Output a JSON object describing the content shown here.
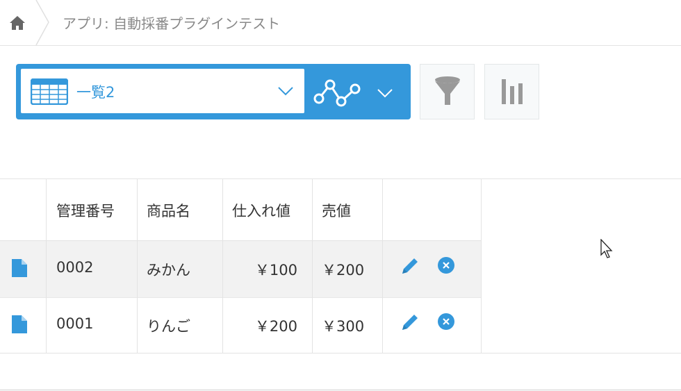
{
  "breadcrumb": {
    "text": "アプリ: 自動採番プラグインテスト"
  },
  "view": {
    "name": "一覧2"
  },
  "table": {
    "headers": [
      "管理番号",
      "商品名",
      "仕入れ値",
      "売値"
    ],
    "rows": [
      {
        "id": "0002",
        "name": "みかん",
        "cost": "￥100",
        "price": "￥200"
      },
      {
        "id": "0001",
        "name": "りんご",
        "cost": "￥200",
        "price": "￥300"
      }
    ]
  },
  "colors": {
    "accent": "#3498db",
    "row_alt": "#f2f2f2"
  }
}
